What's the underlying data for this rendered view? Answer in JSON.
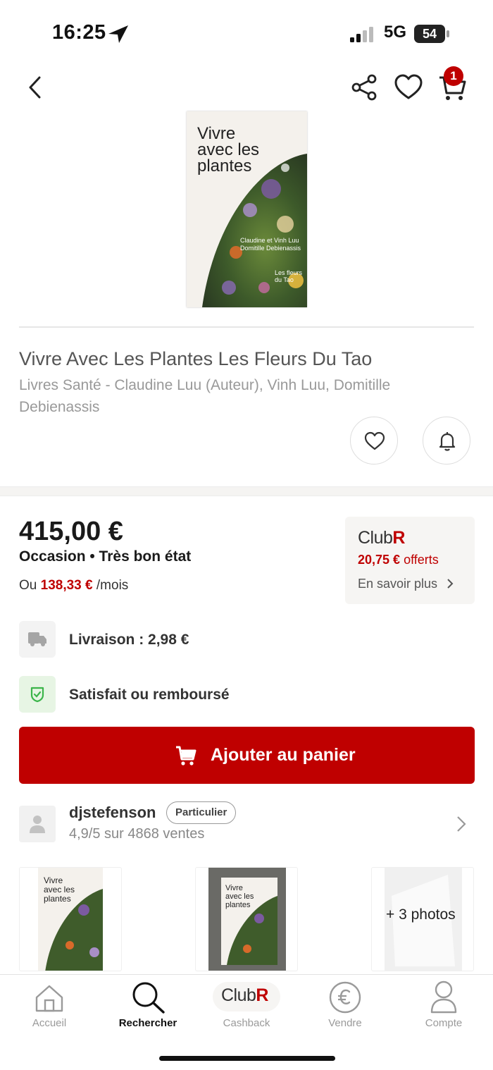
{
  "status_bar": {
    "time": "16:25",
    "network": "5G",
    "battery": "54"
  },
  "header": {
    "cart_count": "1"
  },
  "product": {
    "cover": {
      "title": "Vivre\navec les\nplantes",
      "authors_line": "Claudine et Vinh Luu\nDomitille Debienassis",
      "series_line": "Les fleurs du Tao"
    },
    "title": "Vivre Avec Les Plantes Les Fleurs Du Tao",
    "subtitle": "Livres Santé - Claudine Luu (Auteur), Vinh Luu, Domitille Debienassis"
  },
  "offer": {
    "price": "415,00 €",
    "condition": "Occasion • Très bon état",
    "monthly_prefix": "Ou",
    "monthly_amount": "138,33 €",
    "monthly_suffix": "/mois",
    "delivery": "Livraison : 2,98 €",
    "guarantee": "Satisfait ou remboursé",
    "add_to_cart": "Ajouter au panier"
  },
  "club": {
    "logo_text": "Club",
    "logo_letter": "R",
    "cashback_amount": "20,75 €",
    "cashback_suffix": "offerts",
    "more": "En savoir plus"
  },
  "seller": {
    "name": "djstefenson",
    "badge": "Particulier",
    "rating": "4,9/5 sur 4868 ventes"
  },
  "photos": {
    "more": "+ 3 photos"
  },
  "tabbar": {
    "tabs": [
      {
        "label": "Accueil",
        "icon": "home-icon",
        "active": false
      },
      {
        "label": "Rechercher",
        "icon": "search-icon",
        "active": true
      },
      {
        "label": "Cashback",
        "icon": "club-r-icon",
        "active": false
      },
      {
        "label": "Vendre",
        "icon": "euro-icon",
        "active": false
      },
      {
        "label": "Compte",
        "icon": "user-icon",
        "active": false
      }
    ]
  },
  "colors": {
    "accent": "#bf0000",
    "success": "#3bb54a",
    "background": "#ffffff"
  }
}
